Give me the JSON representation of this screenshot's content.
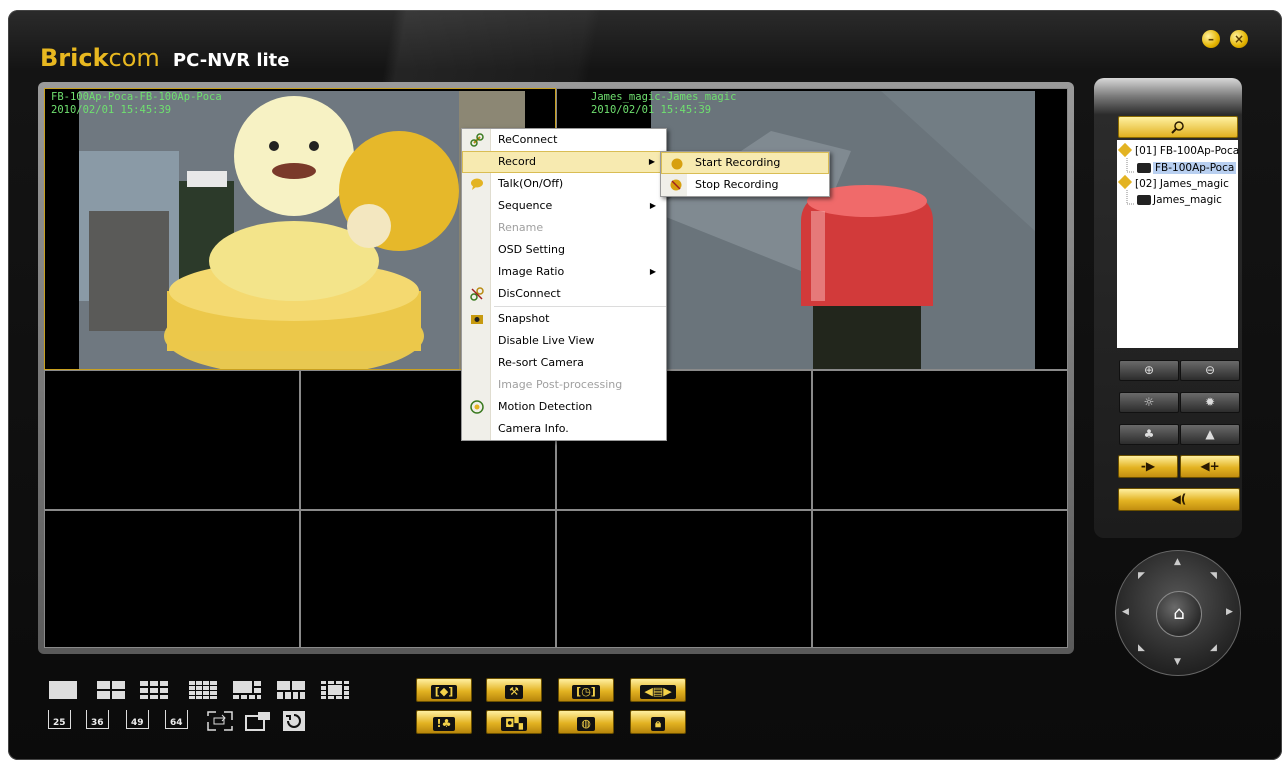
{
  "header": {
    "brand_bold": "Brick",
    "brand_rest": "com",
    "product": "PC-NVR lite"
  },
  "window": {
    "minimize": "–",
    "close": "×"
  },
  "cameras": [
    {
      "title": "FB-100Ap-Poca-FB-100Ap-Poca",
      "timestamp": "2010/02/01 15:45:39"
    },
    {
      "title": "James_magic-James_magic",
      "timestamp": "2010/02/01 15:45:39"
    }
  ],
  "context_menu": {
    "items": [
      {
        "label": "ReConnect",
        "icon": "link-icon"
      },
      {
        "label": "Record",
        "submenu": true
      },
      {
        "label": "Talk(On/Off)",
        "icon": "chat-icon"
      },
      {
        "label": "Sequence",
        "submenu": true
      },
      {
        "label": "Rename",
        "disabled": true
      },
      {
        "label": "OSD Setting"
      },
      {
        "label": "Image Ratio",
        "submenu": true
      },
      {
        "label": "DisConnect",
        "icon": "unlink-icon"
      },
      {
        "label": "Snapshot",
        "icon": "camera-icon"
      },
      {
        "label": "Disable Live View"
      },
      {
        "label": "Re-sort Camera"
      },
      {
        "label": "Image Post-processing",
        "disabled": true
      },
      {
        "label": "Motion Detection",
        "icon": "motion-icon"
      },
      {
        "label": "Camera Info."
      }
    ]
  },
  "record_submenu": {
    "start": "Start Recording",
    "stop": "Stop Recording"
  },
  "tree": {
    "items": [
      {
        "label": "[01] FB-100Ap-Poca"
      },
      {
        "label": "FB-100Ap-Poca"
      },
      {
        "label": "[02] James_magic"
      },
      {
        "label": "James_magic"
      }
    ]
  },
  "audio": {
    "vol_down": "-▶",
    "vol_up": "◀+",
    "speak": "◀("
  },
  "layout_counts": [
    "25",
    "36",
    "49",
    "64"
  ],
  "colors": {
    "accent": "#e3b322",
    "osd_text": "#6fe06f"
  }
}
